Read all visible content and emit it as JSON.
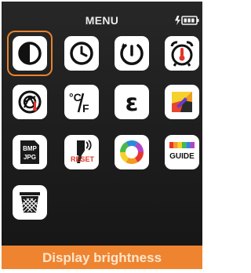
{
  "header": {
    "title": "MENU",
    "battery": "charging"
  },
  "menu": {
    "items": [
      {
        "icon": "brightness-icon",
        "selected": true
      },
      {
        "icon": "clock-icon"
      },
      {
        "icon": "auto-power-off-icon"
      },
      {
        "icon": "alarm-thermometer-icon"
      },
      {
        "icon": "camera-shutter-icon"
      },
      {
        "icon": "temperature-unit-icon",
        "label": "°C/F"
      },
      {
        "icon": "emissivity-icon",
        "label": "ε"
      },
      {
        "icon": "thermal-image-icon"
      },
      {
        "icon": "image-format-icon",
        "label": "BMP JPG"
      },
      {
        "icon": "factory-reset-icon",
        "label": "RESET"
      },
      {
        "icon": "color-palette-icon"
      },
      {
        "icon": "guide-icon",
        "label": "GUIDE"
      },
      {
        "icon": "delete-icon"
      }
    ]
  },
  "footer": {
    "label": "Display brightness"
  },
  "colors": {
    "accent": "#ee8430",
    "background": "#1e1e1e",
    "tile": "#ffffff"
  }
}
